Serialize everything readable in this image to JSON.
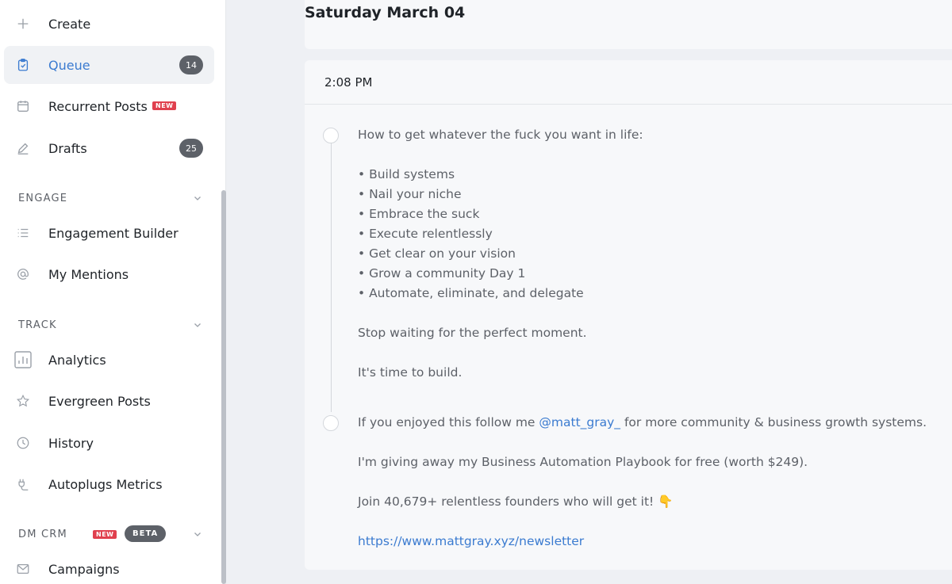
{
  "sidebar": {
    "items": [
      {
        "label": "Create",
        "icon": "plus-icon"
      },
      {
        "label": "Queue",
        "icon": "clipboard-icon",
        "count": "14",
        "active": true
      },
      {
        "label": "Recurrent Posts",
        "icon": "calendar-icon",
        "badge": "NEW"
      },
      {
        "label": "Drafts",
        "icon": "pencil-icon",
        "count": "25"
      }
    ],
    "engage": {
      "title": "ENGAGE",
      "items": [
        {
          "label": "Engagement Builder",
          "icon": "list-icon"
        },
        {
          "label": "My Mentions",
          "icon": "at-icon"
        }
      ]
    },
    "track": {
      "title": "TRACK",
      "items": [
        {
          "label": "Analytics",
          "icon": "bar-chart-icon"
        },
        {
          "label": "Evergreen Posts",
          "icon": "star-icon"
        },
        {
          "label": "History",
          "icon": "clock-icon"
        },
        {
          "label": "Autoplugs Metrics",
          "icon": "plug-icon"
        }
      ]
    },
    "dmcrm": {
      "title": "DM CRM",
      "new_badge": "NEW",
      "beta_badge": "BETA",
      "items": [
        {
          "label": "Campaigns",
          "icon": "envelope-icon"
        }
      ]
    }
  },
  "main": {
    "date_heading": "Saturday March 04",
    "post": {
      "time": "2:08 PM",
      "tweet1": [
        "How to get whatever the fuck you want in life:",
        "",
        "• Build systems",
        "• Nail your niche",
        "• Embrace the suck",
        "• Execute relentlessly",
        "• Get clear on your vision",
        "• Grow a community Day 1",
        "• Automate, eliminate, and delegate",
        "",
        "Stop waiting for the perfect moment.",
        "",
        "It's time to build."
      ],
      "tweet2": {
        "line1_before": "If you enjoyed this follow me ",
        "mention": "@matt_gray_",
        "line1_after": " for more community & business growth systems.",
        "line2": "I'm giving away my Business Automation Playbook for free (worth $249).",
        "line3": "Join 40,679+ relentless founders who will get it! 👇",
        "link": "https://www.mattgray.xyz/newsletter"
      }
    }
  },
  "colors": {
    "accent": "#3b7bd0",
    "new_badge": "#e0404e",
    "count_badge": "#5d6168"
  }
}
